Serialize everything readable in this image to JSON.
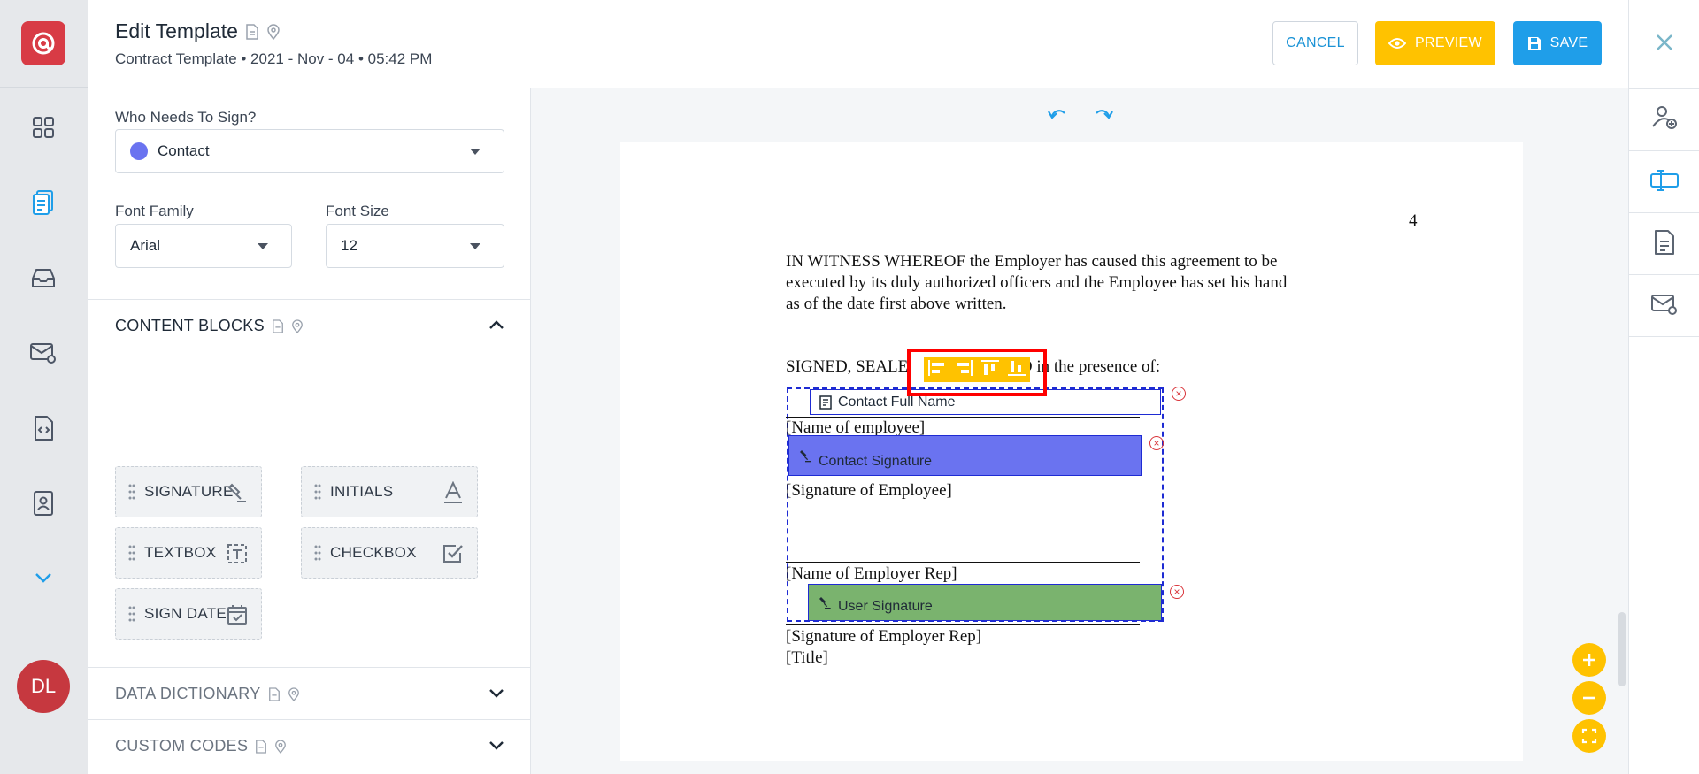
{
  "user": {
    "initials": "DL"
  },
  "colors": {
    "brand": "#d83b45",
    "accent_blue": "#1f9ee9",
    "accent_yellow": "#ffc200",
    "contact_purple": "#6a73f0",
    "user_green": "#7ab36e"
  },
  "header": {
    "title": "Edit Template",
    "subtitle": "Contract Template • 2021 - Nov - 04 • 05:42 PM",
    "cancel_label": "CANCEL",
    "preview_label": "PREVIEW",
    "save_label": "SAVE"
  },
  "panel": {
    "who_label": "Who Needs To Sign?",
    "who_value": "Contact",
    "font_family_label": "Font Family",
    "font_family_value": "Arial",
    "font_size_label": "Font Size",
    "font_size_value": "12",
    "content_blocks_title": "CONTENT BLOCKS",
    "blocks": [
      "SIGNATURE",
      "INITIALS",
      "TEXTBOX",
      "CHECKBOX",
      "SIGN DATE"
    ],
    "data_dictionary_title": "DATA DICTIONARY",
    "custom_codes_title": "CUSTOM CODES"
  },
  "document": {
    "page_number": "4",
    "witness_line1": "IN WITNESS WHEREOF the Employer has caused this agreement to be",
    "witness_line2": "executed by its duly authorized officers and the Employee has set his hand",
    "witness_line3": "as of the date first above written.",
    "signed_prefix": "SIGNED, SEALE",
    "signed_suffix": "ERED in the presence of:",
    "name_employee": "[Name of employee]",
    "sig_employee": "[Signature of Employee]",
    "name_rep": "[Name of Employer Rep]",
    "sig_rep": "[Signature of Employer Rep]",
    "title": "[Title]",
    "fields": {
      "contact_full_name": "Contact Full Name",
      "contact_signature": "Contact Signature",
      "user_signature": "User Signature"
    }
  }
}
